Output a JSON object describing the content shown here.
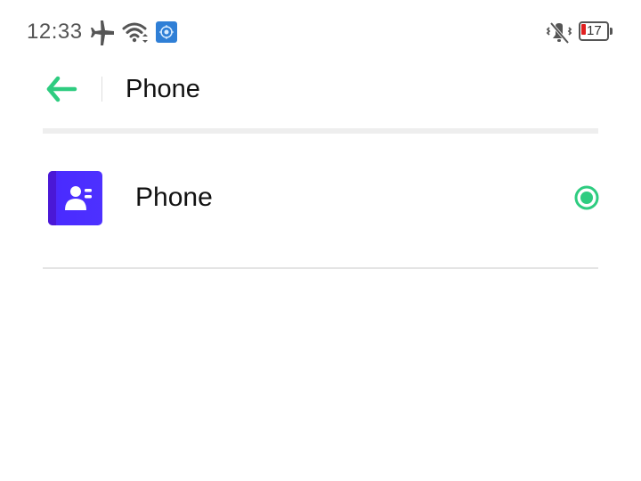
{
  "status_bar": {
    "time": "12:33",
    "battery_percent": "17",
    "battery_color": "#e02020",
    "icons": [
      "airplane-icon",
      "wifi-icon",
      "app-notification-icon",
      "vibrate-icon",
      "battery-icon"
    ]
  },
  "header": {
    "title": "Phone",
    "back_icon": "arrow-left-icon",
    "accent_color": "#2ecc80"
  },
  "list": {
    "items": [
      {
        "label": "Phone",
        "icon": "contacts-app-icon",
        "icon_color": "#4a2bff",
        "selected": true
      }
    ]
  }
}
